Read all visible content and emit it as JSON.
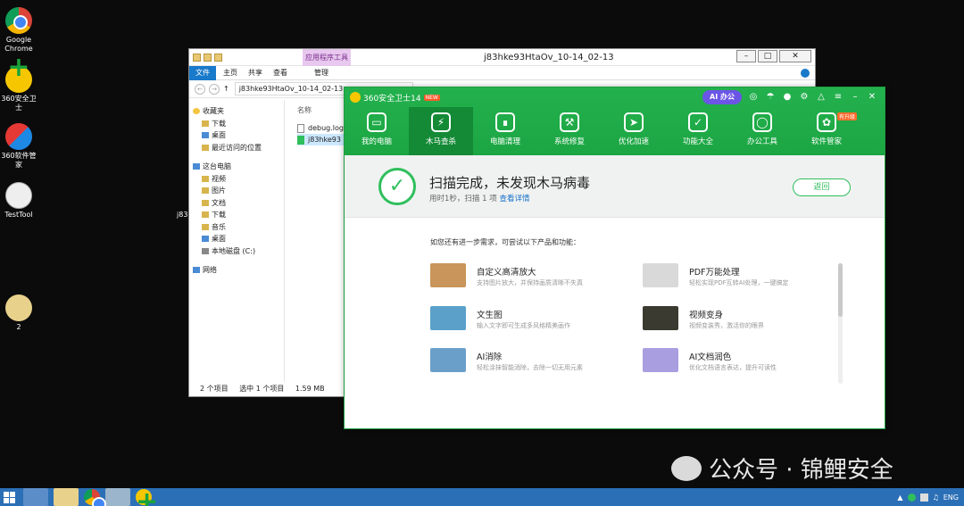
{
  "desktop": {
    "icons": [
      {
        "label": "Google Chrome",
        "icon": "chrome-icon"
      },
      {
        "label": "360安全卫士",
        "icon": "360-security-icon"
      },
      {
        "label": "360软件管家",
        "icon": "360-software-manager-icon"
      },
      {
        "label": "TestTool",
        "icon": "file-icon"
      },
      {
        "label": "2",
        "icon": "folder-icon"
      }
    ],
    "partial_label": "j83"
  },
  "explorer": {
    "context_tab": "应用程序工具",
    "window_title": "j83hke93HtaOv_10-14_02-13",
    "ribbon": {
      "file": "文件",
      "tabs": [
        "主页",
        "共享",
        "查看",
        "管理"
      ]
    },
    "address": "j83hke93HtaOv_10-14_02-13",
    "nav_pane": {
      "favorites": "收藏夹",
      "favorites_items": [
        "下载",
        "桌面",
        "最近访问的位置"
      ],
      "this_pc": "这台电脑",
      "this_pc_items": [
        "视频",
        "图片",
        "文档",
        "下载",
        "音乐",
        "桌面",
        "本地磁盘 (C:)"
      ],
      "network": "网络"
    },
    "column_name": "名称",
    "files": [
      "debug.log",
      "j83hke93"
    ],
    "status": {
      "count": "2 个项目",
      "selection": "选中 1 个项目",
      "size": "1.59 MB"
    }
  },
  "security360": {
    "title": "360安全卫士14",
    "new_badge": "NEW",
    "ai_button": "AI 办公",
    "tabs": [
      {
        "label": "我的电脑",
        "icon": "monitor-icon"
      },
      {
        "label": "木马查杀",
        "icon": "shield-icon"
      },
      {
        "label": "电脑清理",
        "icon": "broom-icon"
      },
      {
        "label": "系统修复",
        "icon": "wrench-icon"
      },
      {
        "label": "优化加速",
        "icon": "rocket-icon"
      },
      {
        "label": "功能大全",
        "icon": "cube-icon"
      },
      {
        "label": "办公工具",
        "icon": "office-icon"
      },
      {
        "label": "软件管家",
        "icon": "apps-icon"
      }
    ],
    "upgrade_badge": "有升级",
    "result": {
      "title": "扫描完成，未发现木马病毒",
      "sub": "用时1秒，扫描 1 项",
      "link": "查看详情",
      "back": "返回"
    },
    "recommend_intro": "如您还有进一步需求，可尝试以下产品和功能：",
    "recommendations": [
      {
        "name": "自定义高清放大",
        "desc": "支持图片放大，并保持画质清晰不失真",
        "color": "#c9955a"
      },
      {
        "name": "PDF万能处理",
        "desc": "轻松实现PDF互转AI处理，一键搞定",
        "color": "#d9d9d9"
      },
      {
        "name": "文生图",
        "desc": "输入文字即可生成多风格精美画作",
        "color": "#5aa0c9"
      },
      {
        "name": "视频变身",
        "desc": "视频变装秀，激活你的眼界",
        "color": "#3a3a30"
      },
      {
        "name": "AI消除",
        "desc": "轻松涂抹智能消除，去除一切无用元素",
        "color": "#6a9fc9"
      },
      {
        "name": "AI文档润色",
        "desc": "优化文档语言表达，提升可读性",
        "color": "#a99ee0"
      }
    ]
  },
  "watermark": "公众号 · 锦鲤安全",
  "taskbar": {
    "language": "ENG"
  }
}
